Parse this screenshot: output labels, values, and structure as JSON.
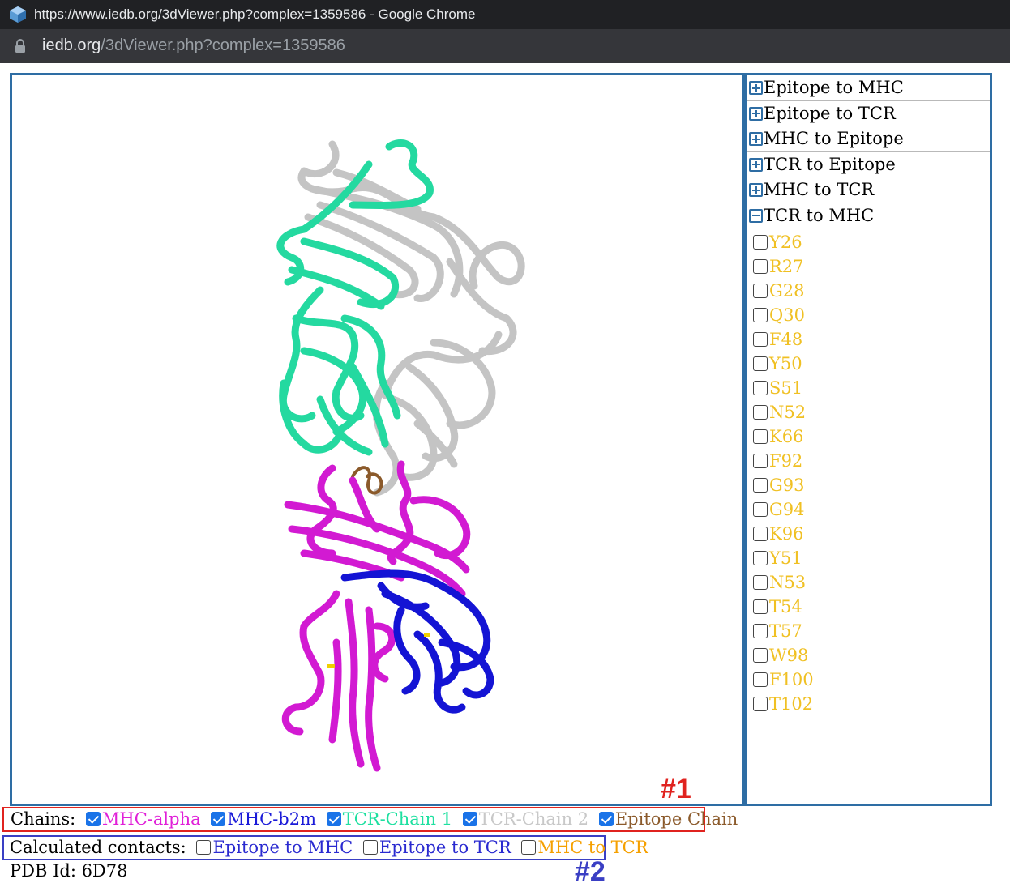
{
  "browser": {
    "window_title": "https://www.iedb.org/3dViewer.php?complex=1359586 - Google Chrome",
    "url_domain": "iedb.org",
    "url_path": "/3dViewer.php?complex=1359586"
  },
  "panel": {
    "sections": [
      {
        "label": "Epitope to MHC",
        "expanded": false
      },
      {
        "label": "Epitope to TCR",
        "expanded": false
      },
      {
        "label": "MHC to Epitope",
        "expanded": false
      },
      {
        "label": "TCR to Epitope",
        "expanded": false
      },
      {
        "label": "MHC to TCR",
        "expanded": false
      },
      {
        "label": "TCR to MHC",
        "expanded": true
      }
    ],
    "residues": [
      "Y26",
      "R27",
      "G28",
      "Q30",
      "F48",
      "Y50",
      "S51",
      "N52",
      "K66",
      "F92",
      "G93",
      "G94",
      "K96",
      "Y51",
      "N53",
      "T54",
      "T57",
      "W98",
      "F100",
      "T102"
    ],
    "residue_color": "#f0c023"
  },
  "chains": {
    "label": "Chains:",
    "items": [
      {
        "label": "MHC-alpha",
        "checked": true,
        "color": "#e020d8"
      },
      {
        "label": "MHC-b2m",
        "checked": true,
        "color": "#1a1ad8"
      },
      {
        "label": "TCR-Chain 1",
        "checked": true,
        "color": "#1ee0a0"
      },
      {
        "label": "TCR-Chain 2",
        "checked": true,
        "color": "#c8c8c8"
      },
      {
        "label": "Epitope Chain",
        "checked": true,
        "color": "#8b5a2b"
      }
    ]
  },
  "contacts": {
    "label": "Calculated contacts:",
    "items": [
      {
        "label": "Epitope to MHC",
        "checked": false,
        "color": "#2a2ad0"
      },
      {
        "label": "Epitope to TCR",
        "checked": false,
        "color": "#2a2ad0"
      },
      {
        "label": "MHC to TCR",
        "checked": false,
        "color": "#f5a000"
      }
    ]
  },
  "pdb": {
    "text": "PDB Id: 6D78"
  },
  "annotations": {
    "marker1": "#1",
    "marker2": "#2"
  }
}
